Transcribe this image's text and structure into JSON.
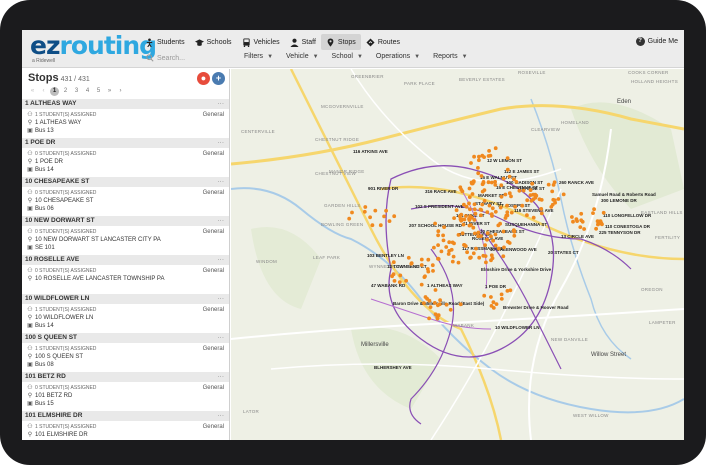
{
  "app": {
    "logo": {
      "part1": "ez",
      "part2": "routing",
      "tagline": "a Ridewell"
    },
    "nav": [
      {
        "label": "Students",
        "icon": "student-icon"
      },
      {
        "label": "Schools",
        "icon": "school-icon"
      },
      {
        "label": "Vehicles",
        "icon": "bus-icon"
      },
      {
        "label": "Staff",
        "icon": "staff-icon"
      },
      {
        "label": "Stops",
        "icon": "pin-icon",
        "active": true
      },
      {
        "label": "Routes",
        "icon": "diamond-icon"
      }
    ],
    "search": {
      "placeholder": "Search..."
    },
    "filters": [
      "Filters",
      "Vehicle",
      "School",
      "Operations",
      "Reports"
    ],
    "guide": "Guide Me"
  },
  "sidebar": {
    "title": "Stops",
    "count": "431 / 431",
    "pager": [
      "«",
      "‹",
      "1",
      "2",
      "3",
      "4",
      "5",
      "»",
      "›"
    ],
    "stops": [
      {
        "name": "1 ALTHEAS WAY",
        "students": "1",
        "address": "1 ALTHEAS WAY",
        "bus": "Bus 13",
        "type": "General"
      },
      {
        "name": "1 POE DR",
        "students": "0",
        "address": "1 POE DR",
        "bus": "Bus 14",
        "type": "General"
      },
      {
        "name": "10 CHESAPEAKE ST",
        "students": "0",
        "address": "10 CHESAPEAKE ST",
        "bus": "Bus 06",
        "type": "General"
      },
      {
        "name": "10 NEW DORWART ST",
        "students": "0",
        "address": "10 NEW DORWART ST LANCASTER CITY PA",
        "bus": "SE 101",
        "type": "General"
      },
      {
        "name": "10 ROSELLE AVE",
        "students": "0",
        "address": "10 ROSELLE AVE LANCASTER TOWNSHIP PA",
        "bus": "",
        "type": "General"
      },
      {
        "name": "10 WILDFLOWER LN",
        "students": "1",
        "address": "10 WILDFLOWER LN",
        "bus": "Bus 14",
        "type": "General"
      },
      {
        "name": "100 S QUEEN ST",
        "students": "1",
        "address": "100 S QUEEN ST",
        "bus": "Bus 08",
        "type": "General"
      },
      {
        "name": "101 BETZ RD",
        "students": "0",
        "address": "101 BETZ RD",
        "bus": "Bus 15",
        "type": "General"
      },
      {
        "name": "101 ELMSHIRE DR",
        "students": "1",
        "address": "101 ELMSHIRE DR",
        "bus": "",
        "type": "General"
      }
    ],
    "students_suffix": "STUDENT(S) ASSIGNED"
  },
  "map": {
    "areas": [
      "GREENBRIER",
      "PARK PLACE",
      "BEVERLY ESTATES",
      "ROSEVILLE",
      "COOKS CORNER",
      "HOLLAND HEIGHTS",
      "MCGOVERNVILLE",
      "Eden",
      "HOMELAND",
      "CLEARVIEW",
      "CENTERVILLE",
      "CHESTNUT RIDGE",
      "CHESTNUT VIEW",
      "MANOR RIDGE",
      "GARDEN HILLS",
      "BOWLING GREEN",
      "LEAF PARK",
      "WINDOM",
      "EASTLAND HILLS",
      "FERTILITY",
      "OREGON",
      "LAMPETER",
      "NEW DANVILLE",
      "Willow Street",
      "WEST WILLOW",
      "LATOR",
      "Millersville",
      "WABANK",
      "WYNNE WOOD MANOR"
    ],
    "stop_labels": [
      "116 ATKINS AVE",
      "12 W LEMON ST",
      "112 E JAMES ST",
      "15 E WALNUT ST",
      "100 MADISON ST",
      "260 RANCK AVE",
      "901 RIVER DR",
      "316 RACE AVE",
      "15 E CHESTNUT ST",
      "Samuel Road & Roberts Road",
      "300 LEMONE DR",
      "ORANGE ST",
      "MARKET ST",
      "102 S PRESIDENT AVE",
      "ST MARY ST",
      "116 STEVENS AVE",
      "ST JOSEPH ST",
      "110 CONESTOGA DR",
      "207 SCHOOL HOUSE RD",
      "104 DUKE ST",
      "110 LONGFELLOW DR",
      "225 TENNYSON DR",
      "SUSQUEHANNA ST",
      "11 RIVER ST",
      "10 CHESAPEAKE ST",
      "BUTTERFLY LN",
      "ROSELLE AVE",
      "13 CIRCLE AVE",
      "103 BENTLEY LN",
      "117 ROSSMAN AVE",
      "40 GREENWOOD AVE",
      "20 STATES CT",
      "12 TOWNSEND CT",
      "Elmshire Drive & Yorkshire Drive",
      "47 WABANK RD",
      "1 ALTHEAS WAY",
      "1 POE DR",
      "Baron Drive & Millersville Road (East Side)",
      "Brewster Drive & Hoover Road",
      "10 WILDFLOWER LN",
      "BLHERSHEY AVE"
    ]
  },
  "colors": {
    "accent_dark": "#0f4e86",
    "accent_light": "#2fa8e0",
    "stop_dot": "#f0891f",
    "route_line": "#8a4fb5",
    "add_red": "#e74c3c",
    "add_blue": "#4a7bb0"
  }
}
